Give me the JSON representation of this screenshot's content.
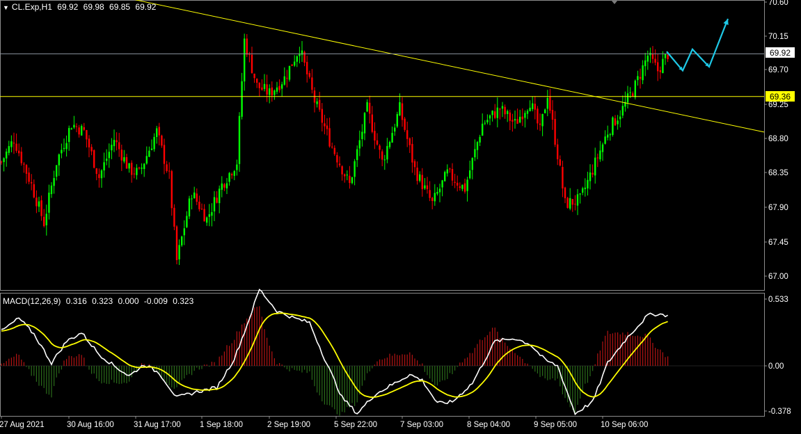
{
  "symbol_header": {
    "menu_icon": "triangle-down-icon",
    "symbol": "CL.Exp,H1",
    "open": "69.92",
    "high": "69.98",
    "low": "69.85",
    "close": "69.92"
  },
  "indicator_header": {
    "name": "MACD(12,26,9)",
    "values": [
      "0.316",
      "0.323",
      "0.000",
      "-0.009",
      "0.323"
    ]
  },
  "colors": {
    "background": "#000000",
    "bull_candle": "#00ff00",
    "bear_candle": "#ff0000",
    "trendline": "#ffff00",
    "support_line": "#ffff00",
    "current_price_line": "#8c94a0",
    "forecast_arrow": "#1ec8e6",
    "macd_line": "#ffffff",
    "signal_line": "#ffff00",
    "hist_positive": "#b31313",
    "hist_negative": "#2a6b1a",
    "grid_border": "#8c8c8c"
  },
  "price_axis": [
    "70.60",
    "70.15",
    "69.70",
    "69.25",
    "68.80",
    "68.35",
    "67.90",
    "67.45",
    "67.00"
  ],
  "current_price_label": "69.92",
  "support_level_label": "69.36",
  "macd_axis": [
    "0.533",
    "0.00",
    "-0.378"
  ],
  "time_axis": [
    "27 Aug 2021",
    "30 Aug 16:00",
    "31 Aug 17:00",
    "1 Sep 18:00",
    "2 Sep 19:00",
    "5 Sep 22:00",
    "7 Sep 03:00",
    "8 Sep 04:00",
    "9 Sep 05:00",
    "10 Sep 06:00"
  ],
  "chart_data": {
    "type": "candlestick",
    "current_price": 69.92,
    "support_level": 69.36,
    "ylim": [
      66.9,
      70.6
    ],
    "macd_ylim": [
      -0.378,
      0.533
    ],
    "trendline": {
      "start": {
        "bar": 0,
        "price": 71.0
      },
      "end": {
        "bar": 260,
        "price": 69.2
      }
    },
    "forecast_path": [
      69.95,
      69.7,
      69.98,
      69.75,
      70.38
    ],
    "price_keyframes": [
      [
        0,
        68.5
      ],
      [
        5,
        68.8
      ],
      [
        12,
        68.2
      ],
      [
        17,
        67.7
      ],
      [
        22,
        68.5
      ],
      [
        28,
        69.0
      ],
      [
        33,
        68.9
      ],
      [
        39,
        68.3
      ],
      [
        45,
        68.8
      ],
      [
        51,
        68.4
      ],
      [
        55,
        68.35
      ],
      [
        62,
        68.9
      ],
      [
        67,
        68.3
      ],
      [
        70,
        67.2
      ],
      [
        76,
        68.1
      ],
      [
        82,
        67.75
      ],
      [
        88,
        68.2
      ],
      [
        94,
        68.5
      ],
      [
        97,
        70.1
      ],
      [
        102,
        69.5
      ],
      [
        107,
        69.4
      ],
      [
        113,
        69.6
      ],
      [
        119,
        70.0
      ],
      [
        125,
        69.3
      ],
      [
        132,
        68.7
      ],
      [
        139,
        68.2
      ],
      [
        146,
        69.2
      ],
      [
        152,
        68.5
      ],
      [
        159,
        69.2
      ],
      [
        165,
        68.4
      ],
      [
        172,
        67.95
      ],
      [
        178,
        68.35
      ],
      [
        185,
        68.15
      ],
      [
        192,
        69.0
      ],
      [
        199,
        69.2
      ],
      [
        205,
        69.0
      ],
      [
        211,
        69.3
      ],
      [
        215,
        68.9
      ],
      [
        218,
        69.4
      ],
      [
        222,
        68.6
      ],
      [
        225,
        67.95
      ],
      [
        231,
        68.0
      ],
      [
        236,
        68.4
      ],
      [
        242,
        68.9
      ],
      [
        248,
        69.2
      ],
      [
        253,
        69.5
      ],
      [
        258,
        69.9
      ],
      [
        262,
        69.7
      ],
      [
        266,
        69.92
      ]
    ],
    "macd_keyframes": [
      [
        0,
        0.24
      ],
      [
        7,
        0.33
      ],
      [
        13,
        0.22
      ],
      [
        20,
        0.02
      ],
      [
        26,
        0.17
      ],
      [
        32,
        0.23
      ],
      [
        39,
        0.08
      ],
      [
        45,
        0.0
      ],
      [
        51,
        -0.07
      ],
      [
        57,
        0.01
      ],
      [
        63,
        -0.05
      ],
      [
        70,
        -0.22
      ],
      [
        78,
        -0.18
      ],
      [
        86,
        -0.15
      ],
      [
        93,
        0.05
      ],
      [
        98,
        0.28
      ],
      [
        103,
        0.53
      ],
      [
        110,
        0.38
      ],
      [
        117,
        0.33
      ],
      [
        123,
        0.3
      ],
      [
        129,
        0.05
      ],
      [
        136,
        -0.22
      ],
      [
        142,
        -0.33
      ],
      [
        149,
        -0.2
      ],
      [
        155,
        -0.14
      ],
      [
        163,
        -0.06
      ],
      [
        168,
        -0.1
      ],
      [
        174,
        -0.26
      ],
      [
        180,
        -0.25
      ],
      [
        188,
        -0.12
      ],
      [
        197,
        0.17
      ],
      [
        205,
        0.19
      ],
      [
        211,
        0.15
      ],
      [
        217,
        0.04
      ],
      [
        222,
        0.0
      ],
      [
        229,
        -0.33
      ],
      [
        236,
        -0.25
      ],
      [
        242,
        0.02
      ],
      [
        250,
        0.2
      ],
      [
        258,
        0.35
      ],
      [
        262,
        0.36
      ],
      [
        266,
        0.35
      ]
    ]
  }
}
